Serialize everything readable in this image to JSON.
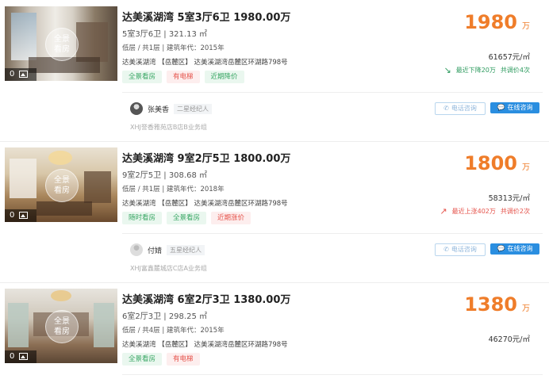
{
  "listings": [
    {
      "title": "达美溪湖湾 5室3厅6卫 1980.00万",
      "spec": "5室3厅6卫 | 321.13 ㎡",
      "meta": "低层 / 共1层 | 建筑年代：2015年",
      "addr_estate": "达美溪湖湾",
      "addr_district": "【岳麓区】",
      "addr_street": "达美溪湖湾岳麓区环湖路798号",
      "tags": [
        "全景看房",
        "有电梯",
        "近期降价"
      ],
      "price": "1980",
      "price_unit": "万",
      "unit_price": "61657元/㎡",
      "trend_text": "最近下降20万",
      "trend_count": "共调价4次",
      "photo_count": "0",
      "vr_label": "全景\n看房",
      "agent_name": "张美香",
      "agent_title": "二星经纪人",
      "agent_branch": "XHJ誉香雅苑店B店B业务组",
      "btn_phone": "电话咨询",
      "btn_chat": "在线咨询"
    },
    {
      "title": "达美溪湖湾 9室2厅5卫 1800.00万",
      "spec": "9室2厅5卫 | 308.68 ㎡",
      "meta": "低层 / 共1层 | 建筑年代：2018年",
      "addr_estate": "达美溪湖湾",
      "addr_district": "【岳麓区】",
      "addr_street": "达美溪湖湾岳麓区环湖路798号",
      "tags": [
        "随时看房",
        "全景看房",
        "近期涨价"
      ],
      "price": "1800",
      "price_unit": "万",
      "unit_price": "58313元/㎡",
      "trend_text": "最近上涨402万",
      "trend_count": "共调价2次",
      "photo_count": "0",
      "vr_label": "全景\n看房",
      "agent_name": "付婧",
      "agent_title": "五星经纪人",
      "agent_branch": "XHJ富鑫麓城店C店A业务组",
      "btn_phone": "电话咨询",
      "btn_chat": "在线咨询"
    },
    {
      "title": "达美溪湖湾 6室2厅3卫 1380.00万",
      "spec": "6室2厅3卫 | 298.25 ㎡",
      "meta": "低层 / 共4层 | 建筑年代：2015年",
      "addr_estate": "达美溪湖湾",
      "addr_district": "【岳麓区】",
      "addr_street": "达美溪湖湾岳麓区环湖路798号",
      "tags": [
        "全景看房",
        "有电梯"
      ],
      "price": "1380",
      "price_unit": "万",
      "unit_price": "46270元/㎡",
      "photo_count": "0",
      "vr_label": "全景\n看房"
    }
  ],
  "colors": {
    "price_orange": "#ef7d2a",
    "tag_green": "#3aa765",
    "tag_red": "#e5534b",
    "chat_blue": "#2a8ee0"
  }
}
